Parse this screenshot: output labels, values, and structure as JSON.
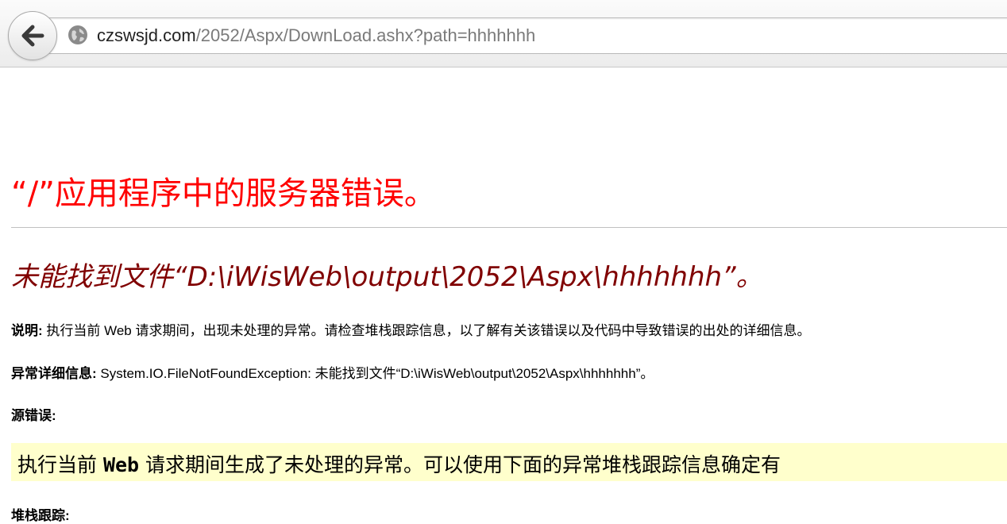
{
  "browser": {
    "url_host": "czswsjd.com",
    "url_path": "/2052/Aspx/DownLoad.ashx?path=hhhhhhh"
  },
  "page": {
    "title": "“/”应用程序中的服务器错误。",
    "error_title": "未能找到文件“D:\\iWisWeb\\output\\2052\\Aspx\\hhhhhhh”。",
    "description_label": "说明:",
    "description_text": " 执行当前 Web 请求期间，出现未处理的异常。请检查堆栈跟踪信息，以了解有关该错误以及代码中导致错误的出处的详细信息。",
    "exception_label": "异常详细信息:",
    "exception_text": " System.IO.FileNotFoundException: 未能找到文件“D:\\iWisWeb\\output\\2052\\Aspx\\hhhhhhh”。",
    "source_error_label": "源错误:",
    "source_box": {
      "part1": "执行当前 ",
      "web": "Web",
      "part2": " 请求期间生成了未处理的异常。可以使用下面的异常堆栈跟踪信息确定有"
    },
    "stack_trace_label": "堆栈跟踪:"
  }
}
